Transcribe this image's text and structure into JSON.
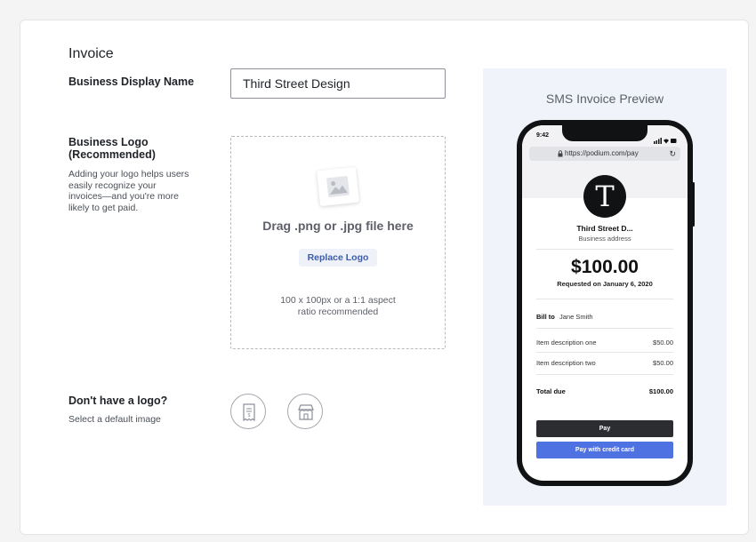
{
  "form": {
    "section_title": "Invoice",
    "display_name_label": "Business Display Name",
    "display_name_value": "Third Street Design",
    "logo_label": "Business Logo (Recommended)",
    "logo_help": "Adding your logo helps users easily recognize your invoices—and you're more likely to get paid.",
    "dropzone_text": "Drag .png or .jpg file here",
    "replace_button": "Replace Logo",
    "ratio_hint": "100 x 100px or a 1:1 aspect ratio recommended",
    "no_logo_label": "Don't have a logo?",
    "no_logo_help": "Select a default image",
    "default_images": [
      "receipt-icon",
      "storefront-icon"
    ]
  },
  "preview": {
    "title": "SMS Invoice Preview",
    "status_time": "9:42",
    "url": "https://podium.com/pay",
    "avatar_letter": "T",
    "business_name": "Third Street D...",
    "business_address": "Business address",
    "amount": "$100.00",
    "requested": "Requested on January 6, 2020",
    "bill_to_label": "Bill to",
    "bill_to_name": "Jane Smith",
    "items": [
      {
        "description": "Item description one",
        "price": "$50.00"
      },
      {
        "description": "Item description two",
        "price": "$50.00"
      }
    ],
    "total_label": "Total due",
    "total_value": "$100.00",
    "apple_pay_label": "Pay",
    "card_pay_label": "Pay with credit card"
  },
  "colors": {
    "accent_blue": "#4f72e3",
    "link_blue": "#3d5ca8",
    "preview_bg": "#f0f3fa",
    "phone_frame": "#111214"
  }
}
